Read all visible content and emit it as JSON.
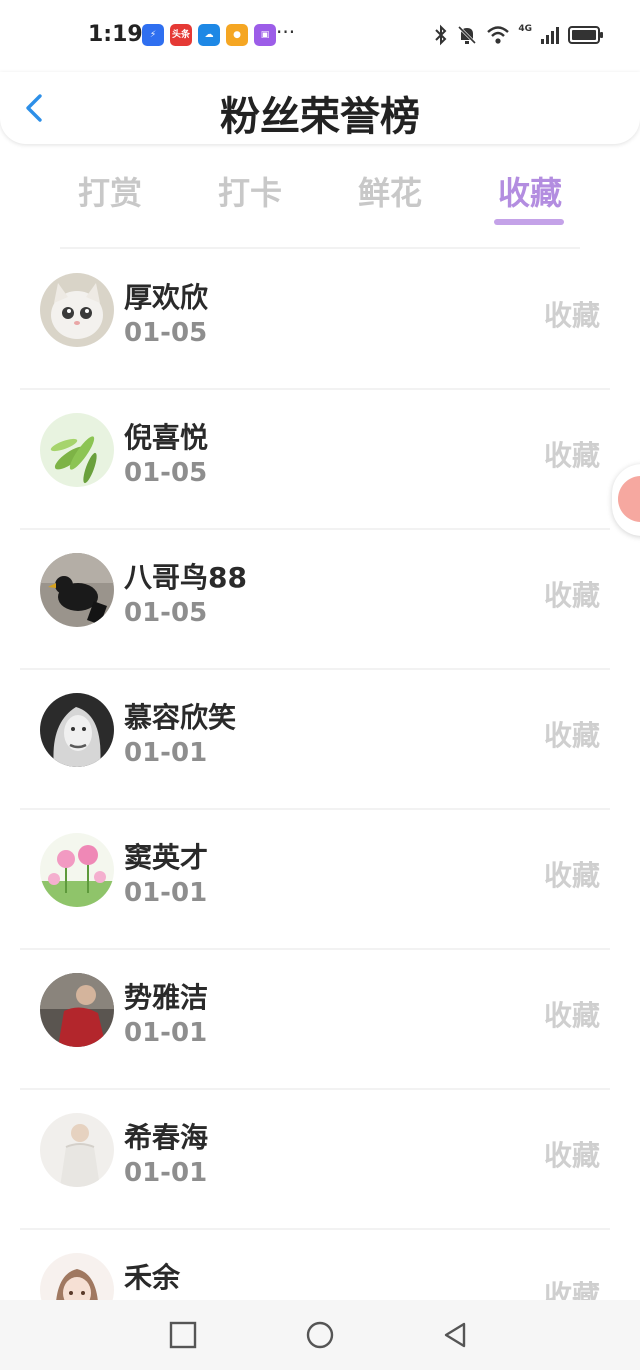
{
  "status_bar": {
    "time": "1:19",
    "notification_icons": [
      {
        "name": "lightning-app-icon",
        "text": ""
      },
      {
        "name": "toutiao-app-icon",
        "text": "头条"
      },
      {
        "name": "weather-app-icon",
        "text": ""
      },
      {
        "name": "game-app-icon",
        "text": ""
      },
      {
        "name": "shop-app-icon",
        "text": ""
      }
    ],
    "more": "···",
    "network_label": "4G"
  },
  "header": {
    "title": "粉丝荣誉榜"
  },
  "tabs": [
    {
      "label": "打赏",
      "active": false
    },
    {
      "label": "打卡",
      "active": false
    },
    {
      "label": "鲜花",
      "active": false
    },
    {
      "label": "收藏",
      "active": true
    }
  ],
  "fans": [
    {
      "name": "厚欢欣",
      "date": "01-05",
      "action": "收藏",
      "avatar": "white-kitten-photo"
    },
    {
      "name": "倪喜悦",
      "date": "01-05",
      "action": "收藏",
      "avatar": "green-leaves-photo"
    },
    {
      "name": "八哥鸟88",
      "date": "01-05",
      "action": "收藏",
      "avatar": "black-bird-photo"
    },
    {
      "name": "慕容欣笑",
      "date": "01-01",
      "action": "收藏",
      "avatar": "bw-portrait-photo"
    },
    {
      "name": "窦英才",
      "date": "01-01",
      "action": "收藏",
      "avatar": "pink-flowers-photo"
    },
    {
      "name": "势雅洁",
      "date": "01-01",
      "action": "收藏",
      "avatar": "man-red-shirt-photo"
    },
    {
      "name": "希春海",
      "date": "01-01",
      "action": "收藏",
      "avatar": "white-shirt-photo"
    },
    {
      "name": "禾余",
      "date": "",
      "action": "收藏",
      "avatar": "anime-girl-photo"
    }
  ],
  "colors": {
    "accent": "#b38de0",
    "indicator": "#c4a2e8",
    "back_arrow": "#2d8fe8",
    "inactive_tab": "#c8c8c8",
    "action_text": "#cfcfcf",
    "date_text": "#8e8e8e"
  }
}
